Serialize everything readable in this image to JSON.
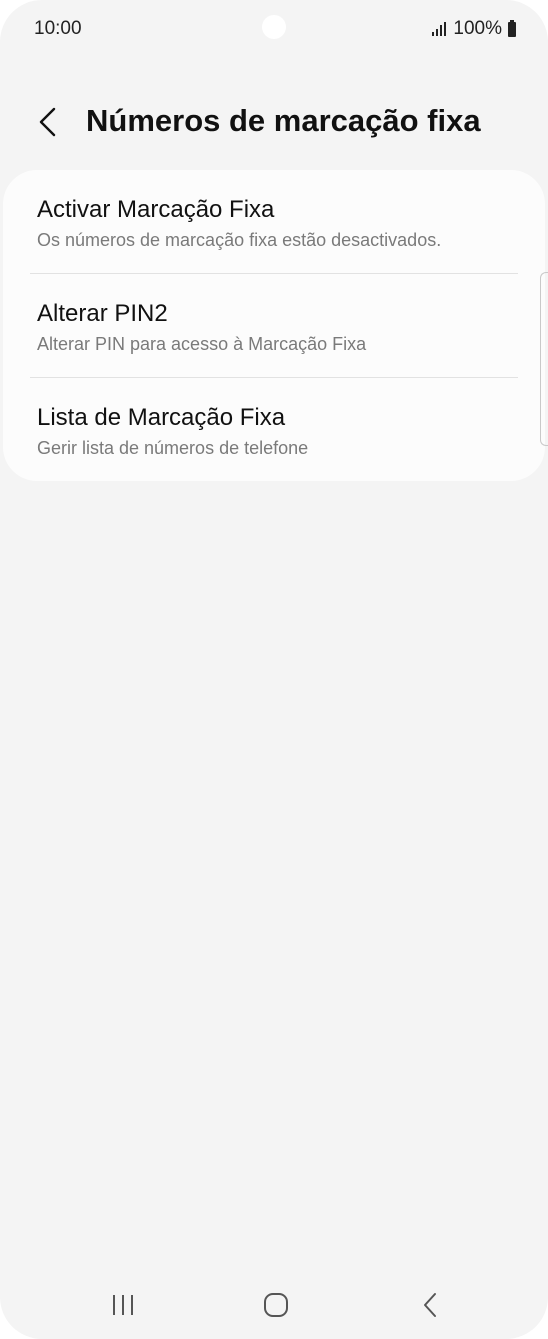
{
  "status_bar": {
    "time": "10:00",
    "battery": "100%"
  },
  "header": {
    "title": "Números de marcação fixa",
    "back_icon": "chevron-left-icon"
  },
  "settings": {
    "items": [
      {
        "title": "Activar Marcação Fixa",
        "subtitle": "Os números de marcação fixa estão desactivados."
      },
      {
        "title": "Alterar PIN2",
        "subtitle": "Alterar PIN para acesso à Marcação Fixa"
      },
      {
        "title": "Lista de Marcação Fixa",
        "subtitle": "Gerir lista de números de telefone"
      }
    ]
  },
  "nav_bar": {
    "icons": [
      "recent-apps-icon",
      "home-icon",
      "back-icon"
    ]
  },
  "colors": {
    "background": "#f4f4f4",
    "card": "#fcfcfc",
    "title_text": "#111111",
    "subtitle_text": "#7a7a7a"
  }
}
